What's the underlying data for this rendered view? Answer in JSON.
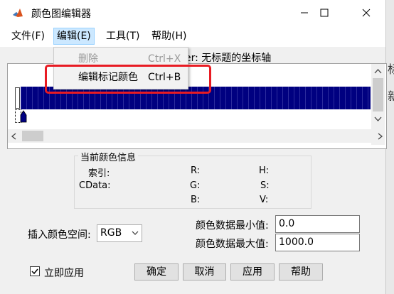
{
  "window": {
    "title": "颜色图编辑器"
  },
  "menubar": [
    {
      "label": "文件(F)"
    },
    {
      "label": "编辑(E)"
    },
    {
      "label": "工具(T)"
    },
    {
      "label": "帮助(H)"
    }
  ],
  "edit_menu": {
    "items": [
      {
        "label": "删除",
        "accelerator": "Ctrl+X",
        "enabled": false
      },
      {
        "label": "编辑标记颜色",
        "accelerator": "Ctrl+B",
        "enabled": true
      }
    ]
  },
  "info_line": "er: 无标题的坐标轴",
  "colormap": {
    "bar_color": "#000080"
  },
  "current_color": {
    "legend": "当前颜色信息",
    "index_label": "索引:",
    "cdata_label": "CData:",
    "r_label": "R:",
    "g_label": "G:",
    "b_label": "B:",
    "h_label": "H:",
    "s_label": "S:",
    "v_label": "V:"
  },
  "colorspace": {
    "label": "插入颜色空间:",
    "value": "RGB"
  },
  "range": {
    "min_label": "颜色数据最小值:",
    "min_value": "0.0",
    "max_label": "颜色数据最大值:",
    "max_value": "1000.0"
  },
  "apply_now": {
    "label": "立即应用",
    "checked": true
  },
  "buttons": {
    "ok": "确定",
    "cancel": "取消",
    "apply": "应用",
    "help": "帮助"
  },
  "background_fragments": {
    "left_top": "琇",
    "left_mid": "fi",
    "right_a": "标",
    "right_b": "新"
  },
  "highlight_color": "#e81b23"
}
